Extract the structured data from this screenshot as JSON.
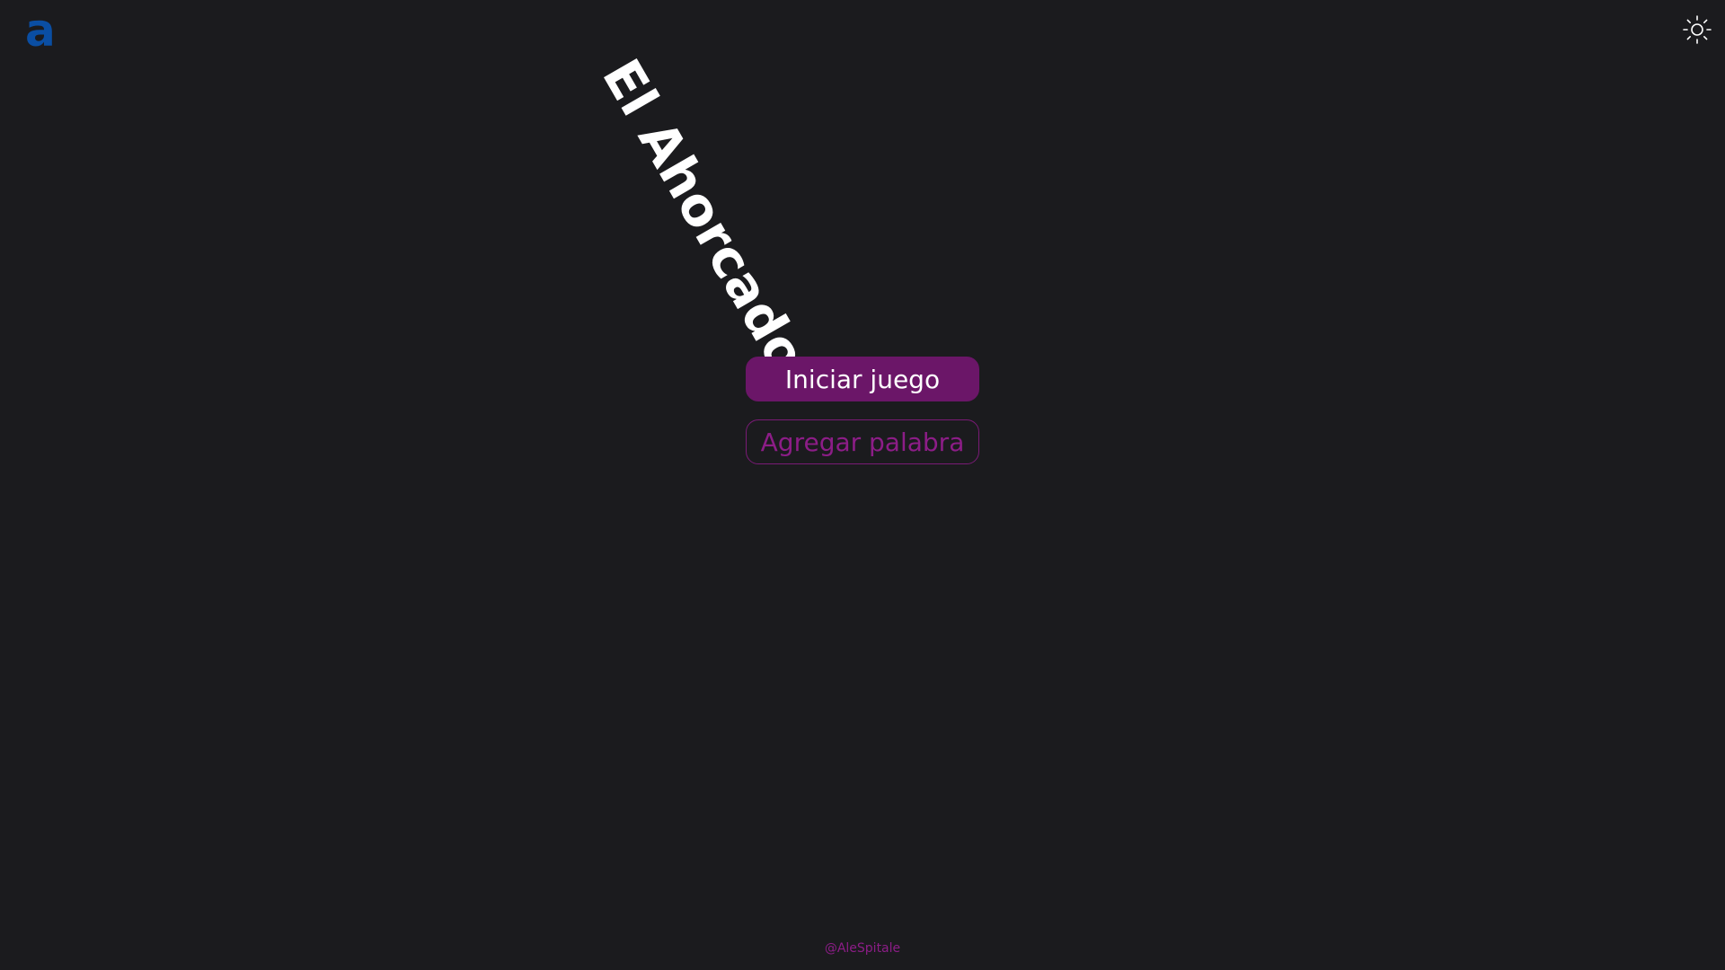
{
  "header": {
    "logo_text": "a",
    "logo_color": "#0a4ea3",
    "theme_toggle_icon": "sun-icon"
  },
  "main": {
    "title": "El Ahorcado",
    "start_button_label": "Iniciar juego",
    "add_word_button_label": "Agregar palabra",
    "accent_color": "#6b1668"
  },
  "footer": {
    "credit": "@AleSpitale"
  },
  "colors": {
    "background": "#1b1b1e",
    "title": "#ffffff",
    "secondary_text": "#8c1d87"
  }
}
